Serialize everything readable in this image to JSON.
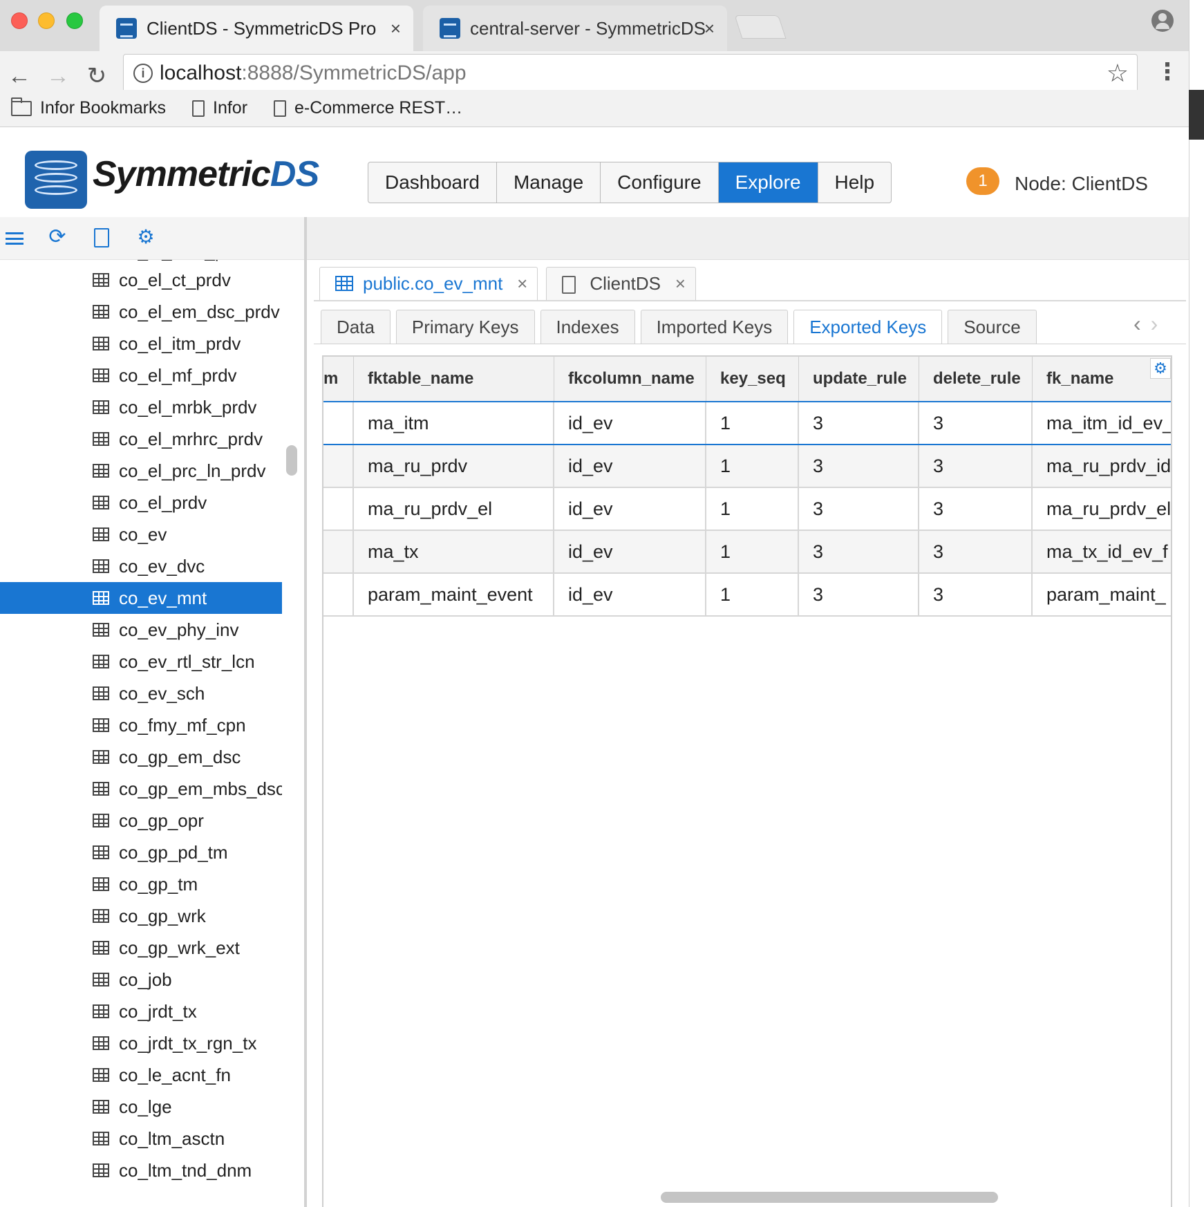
{
  "browser": {
    "tabs": [
      {
        "title": "ClientDS - SymmetricDS Pro",
        "active": true
      },
      {
        "title": "central-server - SymmetricDS",
        "active": false
      }
    ],
    "close_glyph": "×",
    "url_host": "localhost",
    "url_rest": ":8888/SymmetricDS/app",
    "bookmarks": [
      {
        "label": "Infor Bookmarks",
        "icon": "folder-icon"
      },
      {
        "label": "Infor",
        "icon": "page-icon"
      },
      {
        "label": "e-Commerce REST…",
        "icon": "page-icon"
      }
    ]
  },
  "app": {
    "logo_text_main": "Symmetric",
    "logo_text_accent": "DS",
    "nav": [
      "Dashboard",
      "Manage",
      "Configure",
      "Explore",
      "Help"
    ],
    "nav_active": "Explore",
    "notification_count": "1",
    "node_label": "Node: ClientDS",
    "accent_color": "#1976d2",
    "badge_color": "#f0932b"
  },
  "tree": {
    "partial_top_label": "co_el_stac_prdv",
    "items": [
      "co_el_ct_prdv",
      "co_el_em_dsc_prdv",
      "co_el_itm_prdv",
      "co_el_mf_prdv",
      "co_el_mrbk_prdv",
      "co_el_mrhrc_prdv",
      "co_el_prc_ln_prdv",
      "co_el_prdv",
      "co_ev",
      "co_ev_dvc",
      "co_ev_mnt",
      "co_ev_phy_inv",
      "co_ev_rtl_str_lcn",
      "co_ev_sch",
      "co_fmy_mf_cpn",
      "co_gp_em_dsc",
      "co_gp_em_mbs_dsc",
      "co_gp_opr",
      "co_gp_pd_tm",
      "co_gp_tm",
      "co_gp_wrk",
      "co_gp_wrk_ext",
      "co_job",
      "co_jrdt_tx",
      "co_jrdt_tx_rgn_tx",
      "co_le_acnt_fn",
      "co_lge",
      "co_ltm_asctn",
      "co_ltm_tnd_dnm"
    ],
    "selected": "co_ev_mnt"
  },
  "content_tabs": [
    {
      "label": "public.co_ev_mnt",
      "icon": "table-grid-icon",
      "active": true
    },
    {
      "label": "ClientDS",
      "icon": "document-icon",
      "active": false
    }
  ],
  "sub_tabs": [
    "Data",
    "Primary Keys",
    "Indexes",
    "Imported Keys",
    "Exported Keys",
    "Source"
  ],
  "sub_tab_active": "Exported Keys",
  "grid": {
    "columns": [
      "m",
      "fktable_name",
      "fkcolumn_name",
      "key_seq",
      "update_rule",
      "delete_rule",
      "fk_name"
    ],
    "rows": [
      [
        "",
        "ma_itm",
        "id_ev",
        "1",
        "3",
        "3",
        "ma_itm_id_ev_"
      ],
      [
        "",
        "ma_ru_prdv",
        "id_ev",
        "1",
        "3",
        "3",
        "ma_ru_prdv_id"
      ],
      [
        "",
        "ma_ru_prdv_el",
        "id_ev",
        "1",
        "3",
        "3",
        "ma_ru_prdv_el"
      ],
      [
        "",
        "ma_tx",
        "id_ev",
        "1",
        "3",
        "3",
        "ma_tx_id_ev_f"
      ],
      [
        "",
        "param_maint_event",
        "id_ev",
        "1",
        "3",
        "3",
        "param_maint_"
      ]
    ]
  }
}
